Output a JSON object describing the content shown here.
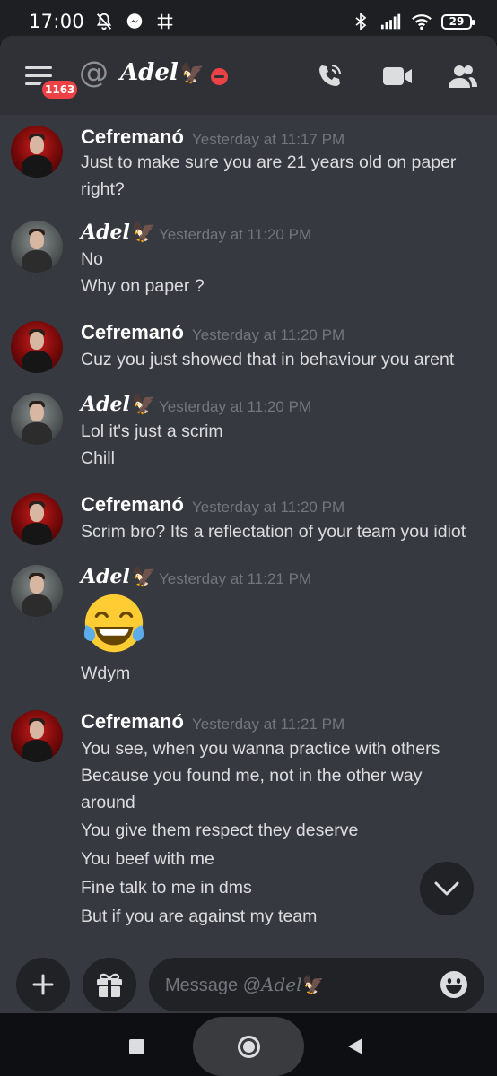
{
  "status_bar": {
    "time": "17:00",
    "battery": "29",
    "icons": [
      "muted-bell-icon",
      "messenger-icon",
      "grid-icon",
      "bluetooth-icon",
      "signal-icon",
      "wifi-icon",
      "battery-icon"
    ]
  },
  "header": {
    "badge_count": "1163",
    "at_symbol": "@",
    "dm_name": "Adel",
    "dm_name_emoji": "🦅",
    "status": "do-not-disturb",
    "icons": [
      "menu-icon",
      "call-icon",
      "video-icon",
      "members-icon"
    ]
  },
  "colors": {
    "background": "#36393f",
    "header": "#2f3136",
    "input": "#202225",
    "badge": "#ed4245",
    "timestamp": "#72767d"
  },
  "messages": [
    {
      "author": "Cefremanó",
      "timestamp": "Yesterday at 11:17 PM",
      "lines": [
        "Just to make sure you are 21 years old on paper",
        "right?"
      ]
    },
    {
      "author": "Adel",
      "author_emoji": "🦅",
      "timestamp": "Yesterday at 11:20 PM",
      "lines": [
        "No",
        "Why on paper ?"
      ]
    },
    {
      "author": "Cefremanó",
      "timestamp": "Yesterday at 11:20 PM",
      "lines": [
        "Cuz you just showed that in behaviour you arent"
      ]
    },
    {
      "author": "Adel",
      "author_emoji": "🦅",
      "timestamp": "Yesterday at 11:20 PM",
      "lines": [
        "Lol it's just a scrim",
        "Chill"
      ]
    },
    {
      "author": "Cefremanó",
      "timestamp": "Yesterday at 11:20 PM",
      "lines": [
        "Scrim bro? Its a reflectation of your team you idiot"
      ]
    },
    {
      "author": "Adel",
      "author_emoji": "🦅",
      "timestamp": "Yesterday at 11:21 PM",
      "emoji": "face-with-tears-of-joy",
      "lines": [
        "Wdym"
      ]
    },
    {
      "author": "Cefremanó",
      "timestamp": "Yesterday at 11:21 PM",
      "lines": [
        "You see, when you wanna practice with others",
        "Because you found me, not in the other way",
        "around",
        "You give them respect they deserve",
        "You beef with me",
        "Fine talk to me in dms",
        "But if you are against my team"
      ]
    }
  ],
  "composer": {
    "placeholder_prefix": "Message @",
    "placeholder_name": "Adel",
    "placeholder_emoji": "🦅",
    "icons": [
      "plus-icon",
      "gift-icon",
      "emoji-icon"
    ]
  },
  "nav": {
    "icons": [
      "recents-icon",
      "home-icon",
      "back-icon"
    ]
  }
}
